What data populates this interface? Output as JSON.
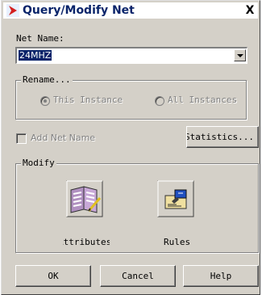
{
  "window": {
    "title": "Query/Modify Net",
    "close_glyph": "X"
  },
  "net_name": {
    "label": "Net Name:",
    "value": "24MHZ"
  },
  "rename": {
    "title": "Rename...",
    "option_this": "This Instance",
    "option_all": "All Instances",
    "selected": "This Instance"
  },
  "add_net_name": {
    "label": "Add Net Name",
    "checked": false
  },
  "statistics_label": "Statistics...",
  "modify": {
    "title": "Modify",
    "attributes_label": "Attributes",
    "rules_label": "Rules"
  },
  "footer": {
    "ok": "OK",
    "cancel": "Cancel",
    "help": "Help"
  },
  "icons": {
    "title": "app-arrow-icon",
    "attributes": "attributes-book-icon",
    "rules": "rules-icon",
    "combo": "chevron-down-icon"
  },
  "colors": {
    "title_text": "#0a246a",
    "selection": "#0a246a",
    "face": "#d4d0c8"
  }
}
